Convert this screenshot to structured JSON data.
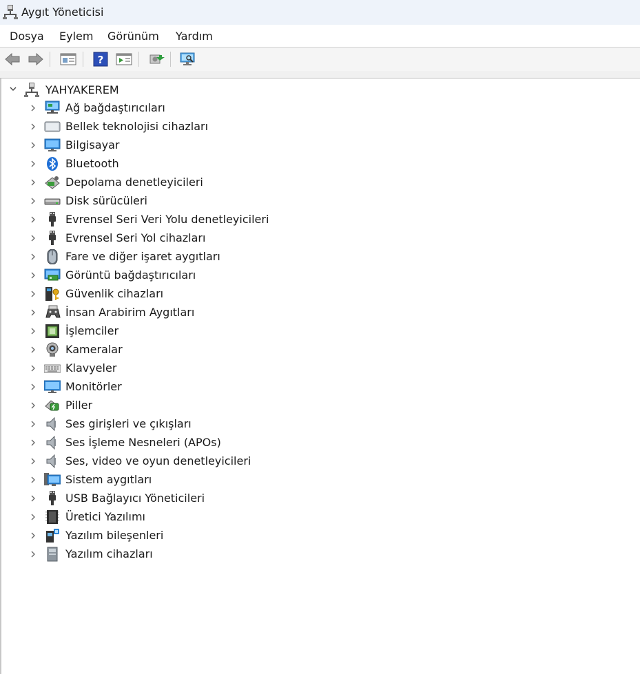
{
  "window": {
    "title": "Aygıt Yöneticisi"
  },
  "menu": [
    "Dosya",
    "Eylem",
    "Görünüm",
    "Yardım"
  ],
  "toolbar": [
    "back-icon",
    "forward-icon",
    "properties-pane-icon",
    "help-icon",
    "action-pane-icon",
    "update-driver-icon",
    "scan-hardware-icon"
  ],
  "tree": {
    "root": {
      "label": "YAHYAKEREM",
      "icon": "computer-network-icon",
      "expanded": true
    },
    "items": [
      {
        "label": "Ağ bağdaştırıcıları",
        "icon": "network-adapter-icon"
      },
      {
        "label": "Bellek teknolojisi cihazları",
        "icon": "memory-device-icon"
      },
      {
        "label": "Bilgisayar",
        "icon": "computer-icon"
      },
      {
        "label": "Bluetooth",
        "icon": "bluetooth-icon"
      },
      {
        "label": "Depolama denetleyicileri",
        "icon": "storage-controller-icon"
      },
      {
        "label": "Disk sürücüleri",
        "icon": "disk-drive-icon"
      },
      {
        "label": "Evrensel Seri Veri Yolu denetleyicileri",
        "icon": "usb-icon"
      },
      {
        "label": "Evrensel Seri Yol cihazları",
        "icon": "usb-icon"
      },
      {
        "label": "Fare ve diğer işaret aygıtları",
        "icon": "mouse-icon"
      },
      {
        "label": "Görüntü bağdaştırıcıları",
        "icon": "display-adapter-icon"
      },
      {
        "label": "Güvenlik cihazları",
        "icon": "security-device-icon"
      },
      {
        "label": "İnsan Arabirim Aygıtları",
        "icon": "hid-icon"
      },
      {
        "label": "İşlemciler",
        "icon": "processor-icon"
      },
      {
        "label": "Kameralar",
        "icon": "camera-icon"
      },
      {
        "label": "Klavyeler",
        "icon": "keyboard-icon"
      },
      {
        "label": "Monitörler",
        "icon": "monitor-icon"
      },
      {
        "label": "Piller",
        "icon": "battery-icon"
      },
      {
        "label": "Ses girişleri ve çıkışları",
        "icon": "speaker-icon"
      },
      {
        "label": "Ses İşleme Nesneleri (APOs)",
        "icon": "speaker-icon"
      },
      {
        "label": "Ses, video ve oyun denetleyicileri",
        "icon": "speaker-icon"
      },
      {
        "label": "Sistem aygıtları",
        "icon": "system-device-icon"
      },
      {
        "label": "USB Bağlayıcı Yöneticileri",
        "icon": "usb-icon"
      },
      {
        "label": "Üretici Yazılımı",
        "icon": "firmware-icon"
      },
      {
        "label": "Yazılım bileşenleri",
        "icon": "software-component-icon"
      },
      {
        "label": "Yazılım cihazları",
        "icon": "software-device-icon"
      }
    ]
  },
  "colors": {
    "titlebar": "#eef3fa",
    "toolbar": "#f5f5f5",
    "accent": "#1a73e8"
  }
}
